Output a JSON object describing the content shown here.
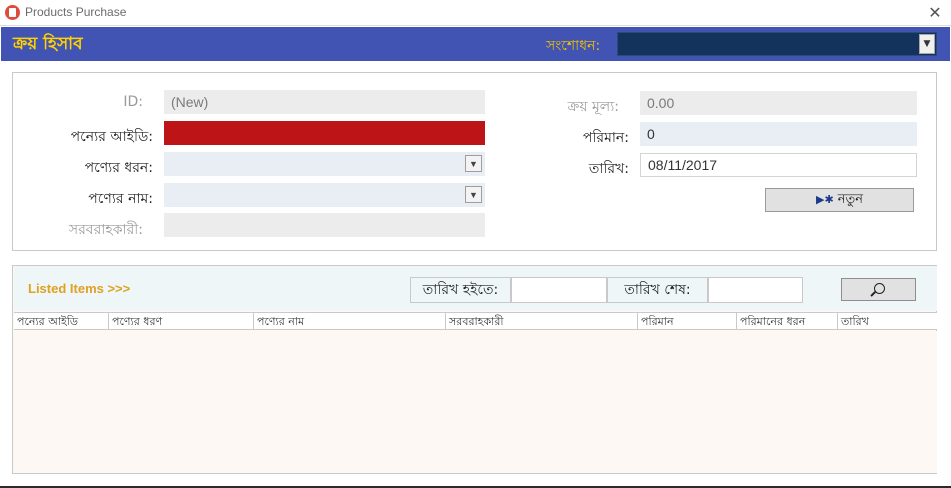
{
  "window": {
    "title": "Products Purchase"
  },
  "header": {
    "title": "ক্রয় হিসাব",
    "revise_label": "সংশোধন:",
    "revise_value": ""
  },
  "form": {
    "id_label": "ID:",
    "id_value": "(New)",
    "product_id_label": "পন্যের আইডি:",
    "product_id_value": "",
    "product_type_label": "পণ্যের ধরন:",
    "product_type_value": "",
    "product_name_label": "পণ্যের নাম:",
    "product_name_value": "",
    "supplier_label": "সরবরাহকারী:",
    "supplier_value": "",
    "price_label": "ক্রয় মূল্য:",
    "price_value": "0.00",
    "quantity_label": "পরিমান:",
    "quantity_value": "0",
    "date_label": "তারিখ:",
    "date_value": "08/11/2017",
    "new_button_label": "নতুন",
    "new_button_icon": "new-record-icon"
  },
  "list": {
    "heading": "Listed Items >>>",
    "date_from_label": "তারিখ হইতে:",
    "date_from_value": "",
    "date_to_label": "তারিখ শেষ:",
    "date_to_value": "",
    "search_icon": "search-icon",
    "columns": [
      "পন্যের আইডি",
      "পণ্যের ধরণ",
      "পণ্যের নাম",
      "সরবরাহকারী",
      "পরিমান",
      "পরিমানের ধরন",
      "তারিখ"
    ],
    "rows": []
  },
  "colors": {
    "header_bg": "#4153b3",
    "header_text": "#ffd200",
    "required_field": "#bd1418",
    "combo_bg": "#14335c",
    "listed_text": "#e0a020"
  }
}
